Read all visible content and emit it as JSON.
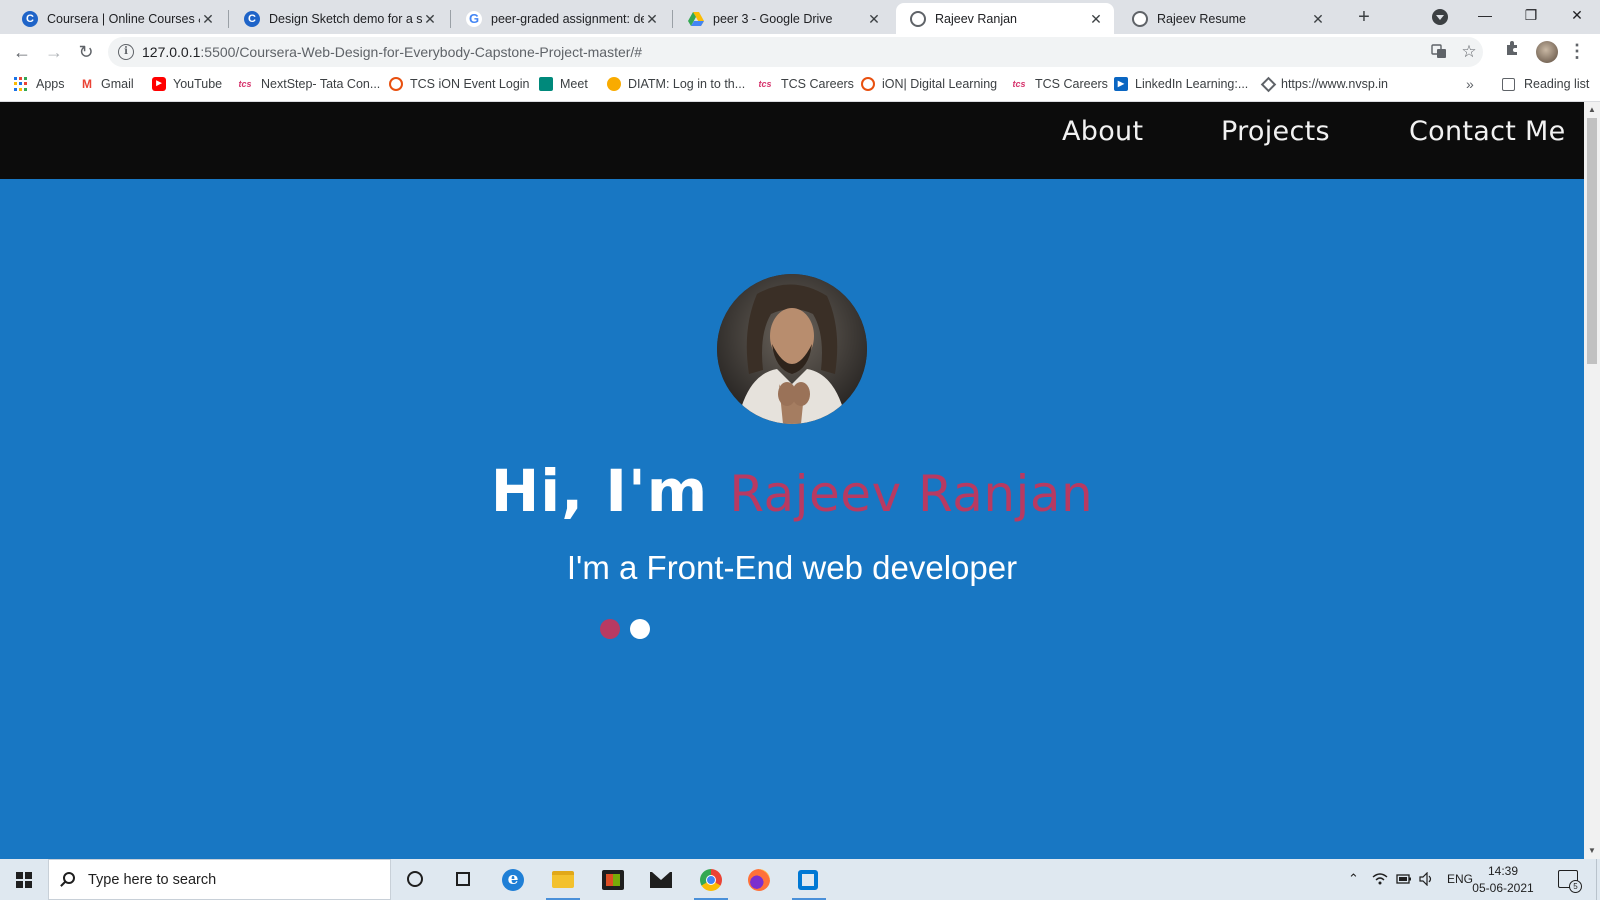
{
  "browser": {
    "tabs": [
      {
        "title": "Coursera | Online Courses & Credentials From Top Educators",
        "icon": "coursera-icon",
        "active": false
      },
      {
        "title": "Design Sketch demo for a site",
        "icon": "coursera-icon",
        "active": false
      },
      {
        "title": "peer-graded assignment: design",
        "icon": "google-icon",
        "active": false
      },
      {
        "title": "peer 3 - Google Drive",
        "icon": "google-drive-icon",
        "active": false
      },
      {
        "title": "Rajeev Ranjan",
        "icon": "globe-icon",
        "active": true
      },
      {
        "title": "Rajeev Resume",
        "icon": "globe-icon",
        "active": false
      }
    ],
    "url_host": "127.0.0.1",
    "url_path": ":5500/Coursera-Web-Design-for-Everybody-Capstone-Project-master/#",
    "bookmarks": [
      {
        "label": "Apps",
        "icon": "apps-grid-icon"
      },
      {
        "label": "Gmail",
        "icon": "gmail-icon"
      },
      {
        "label": "YouTube",
        "icon": "youtube-icon"
      },
      {
        "label": "NextStep- Tata Con...",
        "icon": "tcs-icon"
      },
      {
        "label": "TCS iON Event Login",
        "icon": "tcs-ion-icon"
      },
      {
        "label": "Meet",
        "icon": "google-meet-icon"
      },
      {
        "label": "DIATM: Log in to th...",
        "icon": "diatm-icon"
      },
      {
        "label": "TCS Careers",
        "icon": "tcs-icon"
      },
      {
        "label": "iON| Digital Learning",
        "icon": "tcs-ion-icon"
      },
      {
        "label": "TCS Careers",
        "icon": "tcs-icon"
      },
      {
        "label": "LinkedIn Learning:...",
        "icon": "linkedin-learning-icon"
      },
      {
        "label": "https://www.nvsp.in",
        "icon": "nvsp-icon"
      }
    ],
    "more_bookmarks": "»",
    "reading_list": "Reading list"
  },
  "site": {
    "nav": {
      "about": "About",
      "projects": "Projects",
      "contact": "Contact Me"
    },
    "hero": {
      "greeting": "Hi, I'm ",
      "name": "Rajeev Ranjan",
      "tagline": "I'm a Front-End web developer",
      "carousel_dots": 2,
      "carousel_active_index": 0
    },
    "colors": {
      "nav_bg": "#0c0c0c",
      "hero_bg": "#1877c3",
      "accent": "#b83a62",
      "text": "#ffffff"
    }
  },
  "taskbar": {
    "search_placeholder": "Type here to search",
    "language": "ENG",
    "time": "14:39",
    "date": "05-06-2021",
    "notification_count": "5",
    "pinned_apps": [
      "cortana",
      "task-view",
      "edge",
      "file-explorer",
      "microsoft-store",
      "mail",
      "chrome",
      "firefox",
      "vs-code"
    ]
  }
}
